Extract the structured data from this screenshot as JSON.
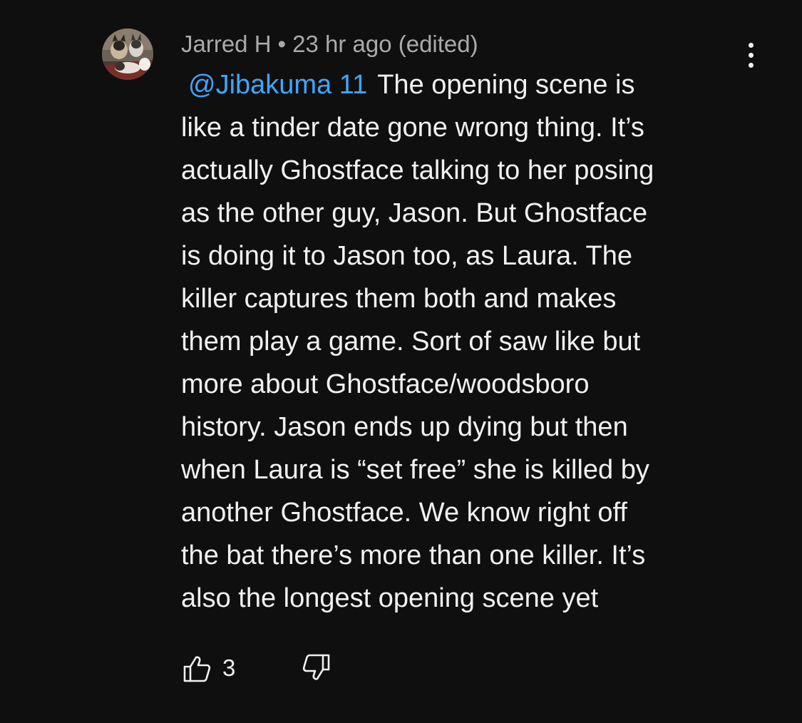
{
  "comment": {
    "author": "Jarred H",
    "separator": "•",
    "timestamp": "23 hr ago (edited)",
    "mention": "@Jibakuma 11",
    "lines": [
      "The opening scene is",
      "like a tinder date gone wrong thing. It’s",
      "actually Ghostface talking to her posing",
      "as the other guy, Jason. But Ghostface",
      "is doing it to Jason too, as Laura. The",
      "killer captures them both and makes",
      "them play a game. Sort of saw like but",
      "more about Ghostface/woodsboro",
      "history. Jason ends up dying but then",
      "when Laura is “set free” she is killed by",
      "another Ghostface. We know right off",
      "the bat there’s more than one killer. It’s",
      "also the longest opening scene yet"
    ],
    "like_count": "3"
  },
  "icons": {
    "avatar": "avatar-photo-dogs",
    "menu": "more-vert-icon",
    "like": "thumbs-up-icon",
    "dislike": "thumbs-down-icon"
  },
  "colors": {
    "background": "#0f0f0f",
    "text": "#f1f1f1",
    "meta": "#aaaaaa",
    "mention": "#3ea6ff"
  }
}
